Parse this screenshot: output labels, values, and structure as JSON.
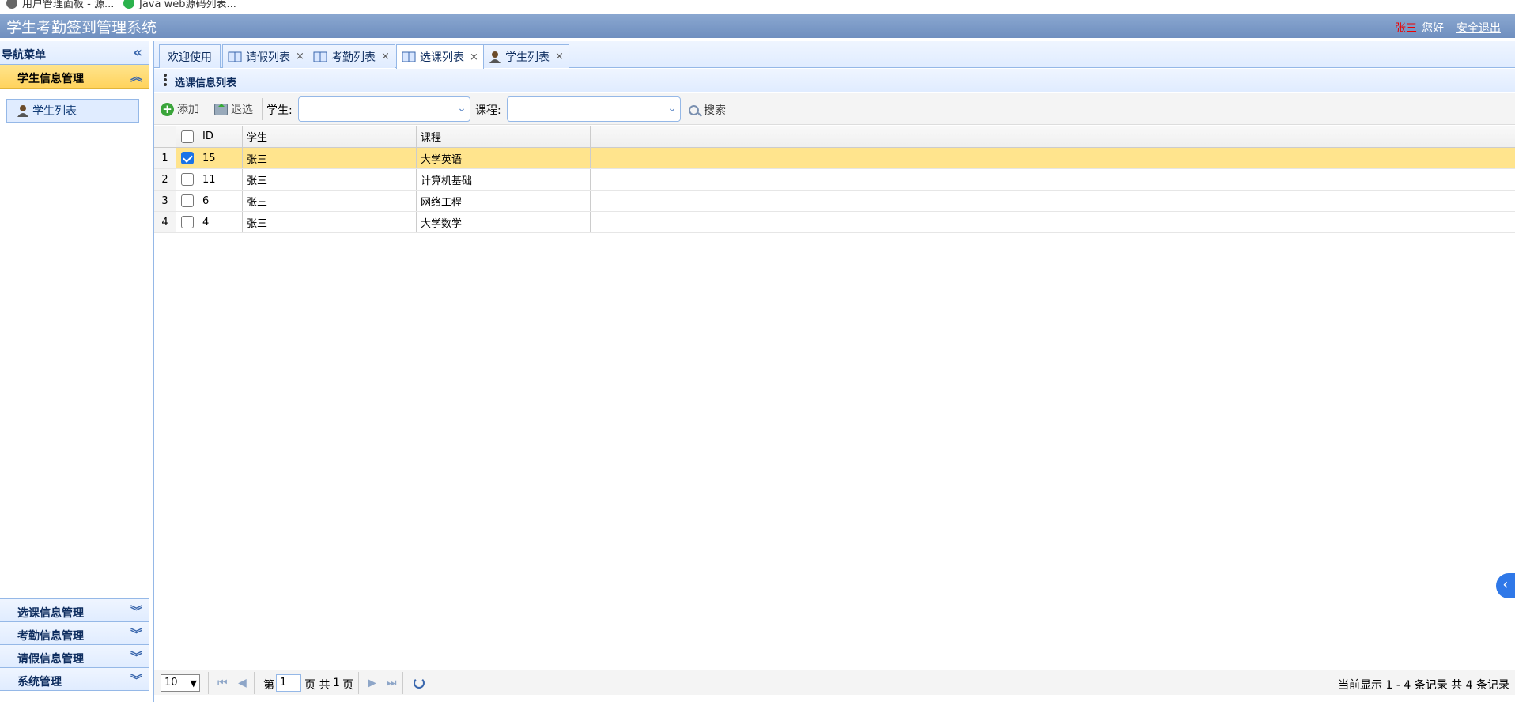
{
  "bookmarks": [
    {
      "label": "用户管理面板 - 源..."
    },
    {
      "label": "Java web源码列表..."
    }
  ],
  "app": {
    "title": "学生考勤签到管理系统",
    "user_name": "张三",
    "greeting": "您好",
    "logout": "安全退出"
  },
  "nav": {
    "header": "导航菜单",
    "open_section": "学生信息管理",
    "items": [
      {
        "label": "学生列表"
      }
    ],
    "sections": [
      {
        "label": "选课信息管理"
      },
      {
        "label": "考勤信息管理"
      },
      {
        "label": "请假信息管理"
      },
      {
        "label": "系统管理"
      }
    ]
  },
  "tabs": [
    {
      "label": "欢迎使用"
    },
    {
      "label": "请假列表"
    },
    {
      "label": "考勤列表"
    },
    {
      "label": "选课列表"
    },
    {
      "label": "学生列表"
    }
  ],
  "panel": {
    "title": "选课信息列表"
  },
  "toolbar": {
    "add": "添加",
    "withdraw": "退选",
    "student_label": "学生:",
    "course_label": "课程:",
    "search": "搜索"
  },
  "grid": {
    "columns": {
      "id": "ID",
      "student": "学生",
      "course": "课程"
    },
    "rows": [
      {
        "n": "1",
        "id": "15",
        "student": "张三",
        "course": "大学英语",
        "checked": true
      },
      {
        "n": "2",
        "id": "11",
        "student": "张三",
        "course": "计算机基础",
        "checked": false
      },
      {
        "n": "3",
        "id": "6",
        "student": "张三",
        "course": "网络工程",
        "checked": false
      },
      {
        "n": "4",
        "id": "4",
        "student": "张三",
        "course": "大学数学",
        "checked": false
      }
    ]
  },
  "pager": {
    "page_size": "10",
    "page_prefix": "第",
    "page_value": "1",
    "page_mid": "页 共",
    "total_pages": "1",
    "page_suffix": "页",
    "info": "当前显示 1 - 4 条记录 共 4 条记录"
  },
  "colors": {
    "accent": "#95b8e7",
    "selected_row": "#ffe48d",
    "user_name": "#ee0000"
  }
}
